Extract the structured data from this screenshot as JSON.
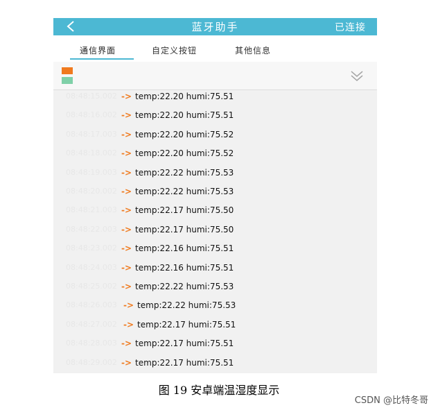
{
  "titlebar": {
    "title": "蓝牙助手",
    "status": "已连接",
    "back_icon": "chevron-left-icon"
  },
  "tabs": [
    {
      "label": "通信界面",
      "active": true
    },
    {
      "label": "自定义按钮",
      "active": false
    },
    {
      "label": "其他信息",
      "active": false
    }
  ],
  "toolbar": {
    "swatches": [
      "#f07a1e",
      "#7fd0a8"
    ],
    "expand_icon": "double-chevron-down-icon"
  },
  "log": {
    "arrow": "->",
    "rows": [
      {
        "time": "08:48:15.002",
        "text": "temp:22.20 humi:75.51"
      },
      {
        "time": "08:48:16.002",
        "text": "temp:22.20 humi:75.51"
      },
      {
        "time": "08:48:17.003",
        "text": "temp:22.20 humi:75.52"
      },
      {
        "time": "08:48:18.002",
        "text": "temp:22.20 humi:75.52"
      },
      {
        "time": "08:48:19.003",
        "text": "temp:22.22 humi:75.53"
      },
      {
        "time": "08:48:20.002",
        "text": "temp:22.22 humi:75.53"
      },
      {
        "time": "08:48:21.003",
        "text": "temp:22.17 humi:75.50"
      },
      {
        "time": "08:48:22.003",
        "text": "temp:22.17 humi:75.50"
      },
      {
        "time": "08:48:23.002",
        "text": "temp:22.16 humi:75.51"
      },
      {
        "time": "08:48:24.003",
        "text": "temp:22.16 humi:75.51"
      },
      {
        "time": "08:48:25.002",
        "text": "temp:22.22 humi:75.53"
      },
      {
        "time": "08:48:26.003",
        "text": "temp:22.22 humi:75.53"
      },
      {
        "time": "08:48:27.002",
        "text": "temp:22.17 humi:75.51"
      },
      {
        "time": "08:48:28.003",
        "text": "temp:22.17 humi:75.51"
      },
      {
        "time": "08:48:29.002",
        "text": "temp:22.17 humi:75.51"
      }
    ]
  },
  "caption": "图 19   安卓端温湿度显示",
  "watermark": "CSDN @比特冬哥"
}
